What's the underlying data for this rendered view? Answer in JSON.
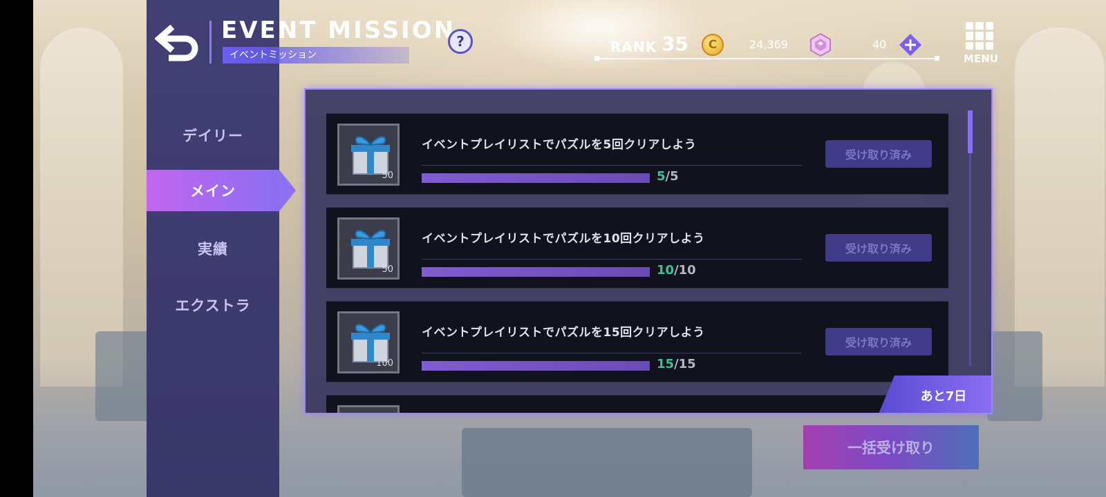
{
  "header": {
    "title": "EVENT MISSION",
    "subtitle": "イベントミッション",
    "help_symbol": "?"
  },
  "status": {
    "rank_label": "RANK",
    "rank_value": "35",
    "coin_symbol": "C",
    "coins": "24,369",
    "gems": "40",
    "menu_label": "MENU"
  },
  "tabs": [
    {
      "label": "デイリー",
      "active": false
    },
    {
      "label": "メイン",
      "active": true
    },
    {
      "label": "実績",
      "active": false
    },
    {
      "label": "エクストラ",
      "active": false
    }
  ],
  "missions": [
    {
      "text": "イベントプレイリストでパズルを5回クリアしよう",
      "reward_count": "50",
      "current": "5",
      "total": "/5",
      "progress": 1.0,
      "button": "受け取り済み"
    },
    {
      "text": "イベントプレイリストでパズルを10回クリアしよう",
      "reward_count": "50",
      "current": "10",
      "total": "/10",
      "progress": 1.0,
      "button": "受け取り済み"
    },
    {
      "text": "イベントプレイリストでパズルを15回クリアしよう",
      "reward_count": "100",
      "current": "15",
      "total": "/15",
      "progress": 1.0,
      "button": "受け取り済み"
    }
  ],
  "remaining": "あと7日",
  "bulk_claim_label": "一括受け取り",
  "colors": {
    "accent": "#8b6ff0",
    "progress_complete": "#3fbf93",
    "panel_border": "#9b87f5"
  }
}
